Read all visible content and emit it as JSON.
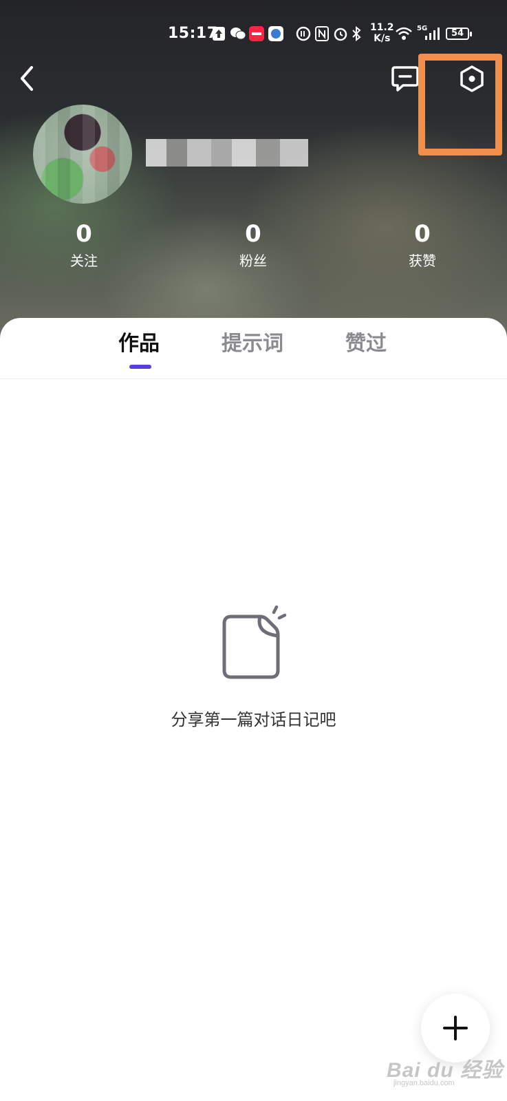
{
  "status_bar": {
    "time": "15:17",
    "network_speed_value": "11.2",
    "network_speed_unit": "K/s",
    "network_type": "5G",
    "battery": "54"
  },
  "header": {
    "back_icon": "chevron-left-icon",
    "message_icon": "message-bubble-icon",
    "settings_icon": "settings-hexagon-icon",
    "highlight_color": "#f0904c"
  },
  "profile": {
    "stats": [
      {
        "value": "0",
        "label": "关注"
      },
      {
        "value": "0",
        "label": "粉丝"
      },
      {
        "value": "0",
        "label": "获赞"
      }
    ]
  },
  "tabs": [
    {
      "label": "作品",
      "active": true
    },
    {
      "label": "提示词",
      "active": false
    },
    {
      "label": "赞过",
      "active": false
    }
  ],
  "accent_color": "#5b3fe6",
  "empty_state": {
    "icon": "empty-document-icon",
    "text": "分享第一篇对话日记吧"
  },
  "fab": {
    "icon": "plus-icon"
  },
  "watermark": {
    "main": "Bai du 经验",
    "sub": "jingyan.baidu.com"
  }
}
